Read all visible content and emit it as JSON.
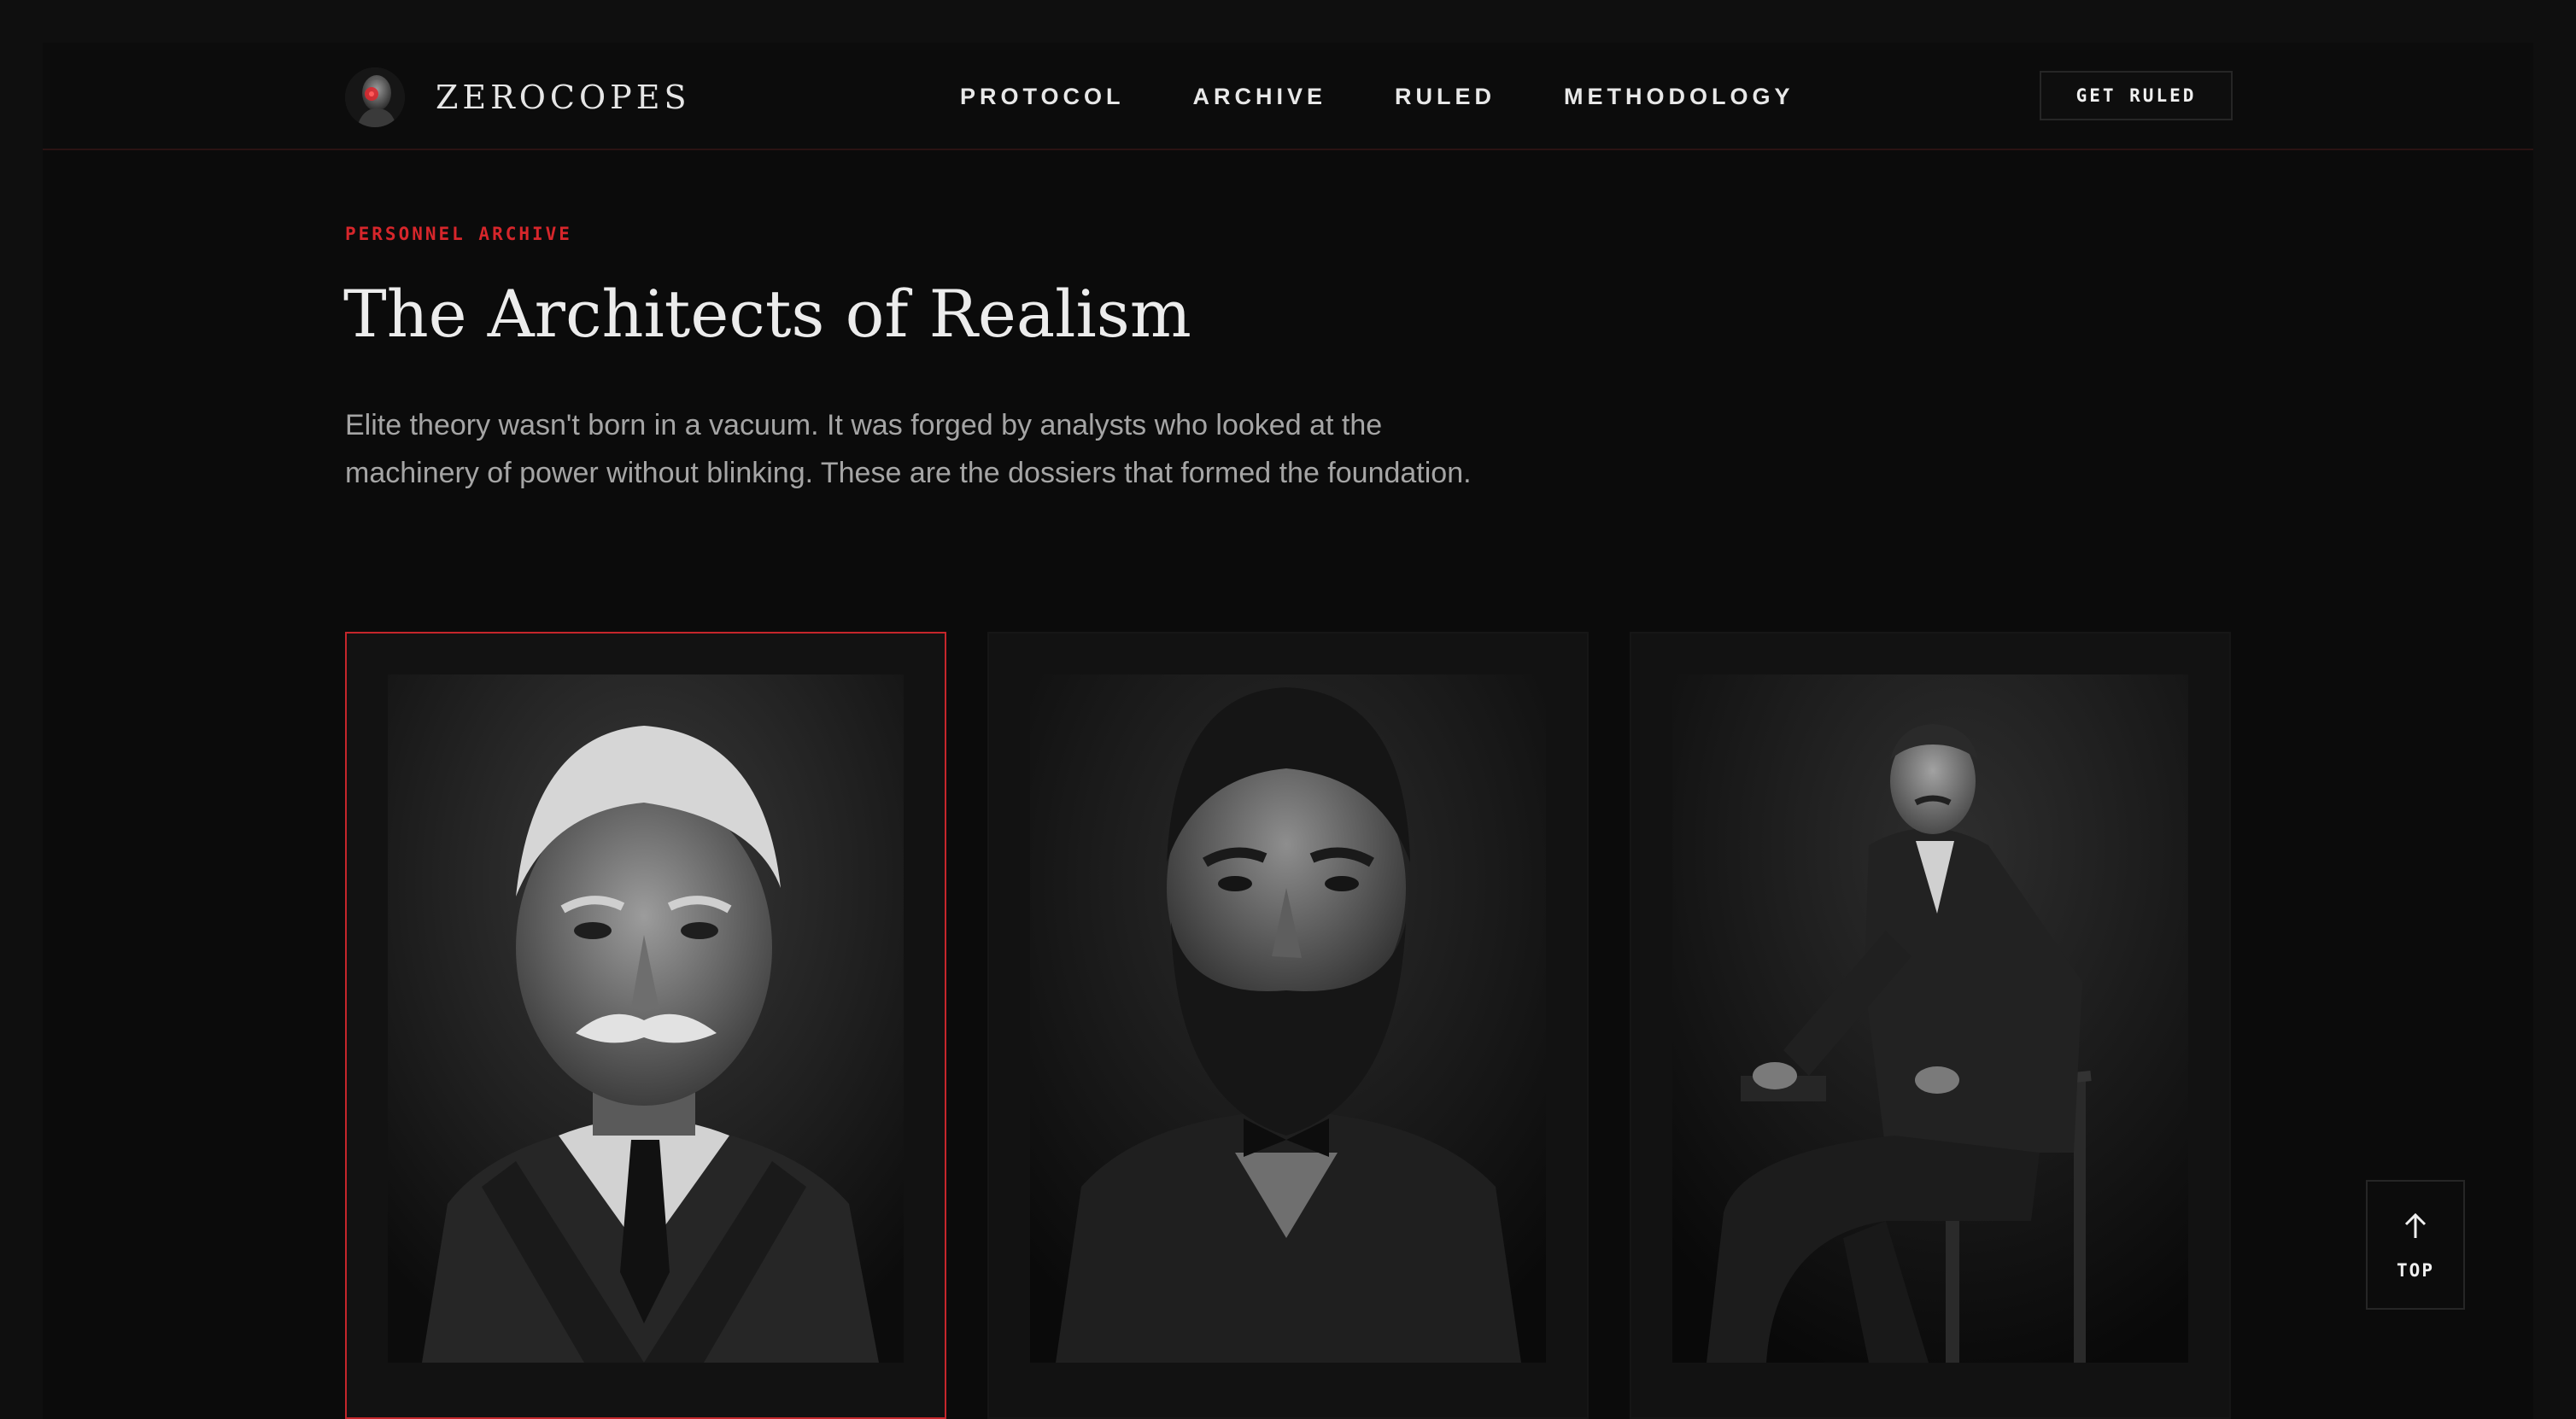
{
  "brand": {
    "name": "ZEROCOPES",
    "logo_icon": "statue-bust-red-eye-icon"
  },
  "nav": {
    "items": [
      {
        "label": "PROTOCOL"
      },
      {
        "label": "ARCHIVE"
      },
      {
        "label": "RULED"
      },
      {
        "label": "METHODOLOGY"
      }
    ],
    "cta_label": "GET RULED"
  },
  "hero": {
    "eyebrow": "PERSONNEL ARCHIVE",
    "title": "The Architects of Realism",
    "intro": "Elite theory wasn't born in a vacuum. It was forged by analysts who looked at the machinery of power without blinking. These are the dossiers that formed the foundation."
  },
  "cards": [
    {
      "portrait": "portrait-elderly-man-mustache",
      "active": true
    },
    {
      "portrait": "portrait-bearded-man",
      "active": false
    },
    {
      "portrait": "portrait-seated-man-mustache",
      "active": false
    }
  ],
  "top_button": {
    "label": "TOP",
    "icon": "arrow-up-icon"
  },
  "colors": {
    "accent": "#d7262b",
    "background": "#0b0b0b",
    "card": "#121212",
    "text": "#ececec",
    "muted": "#a5a5a5"
  }
}
